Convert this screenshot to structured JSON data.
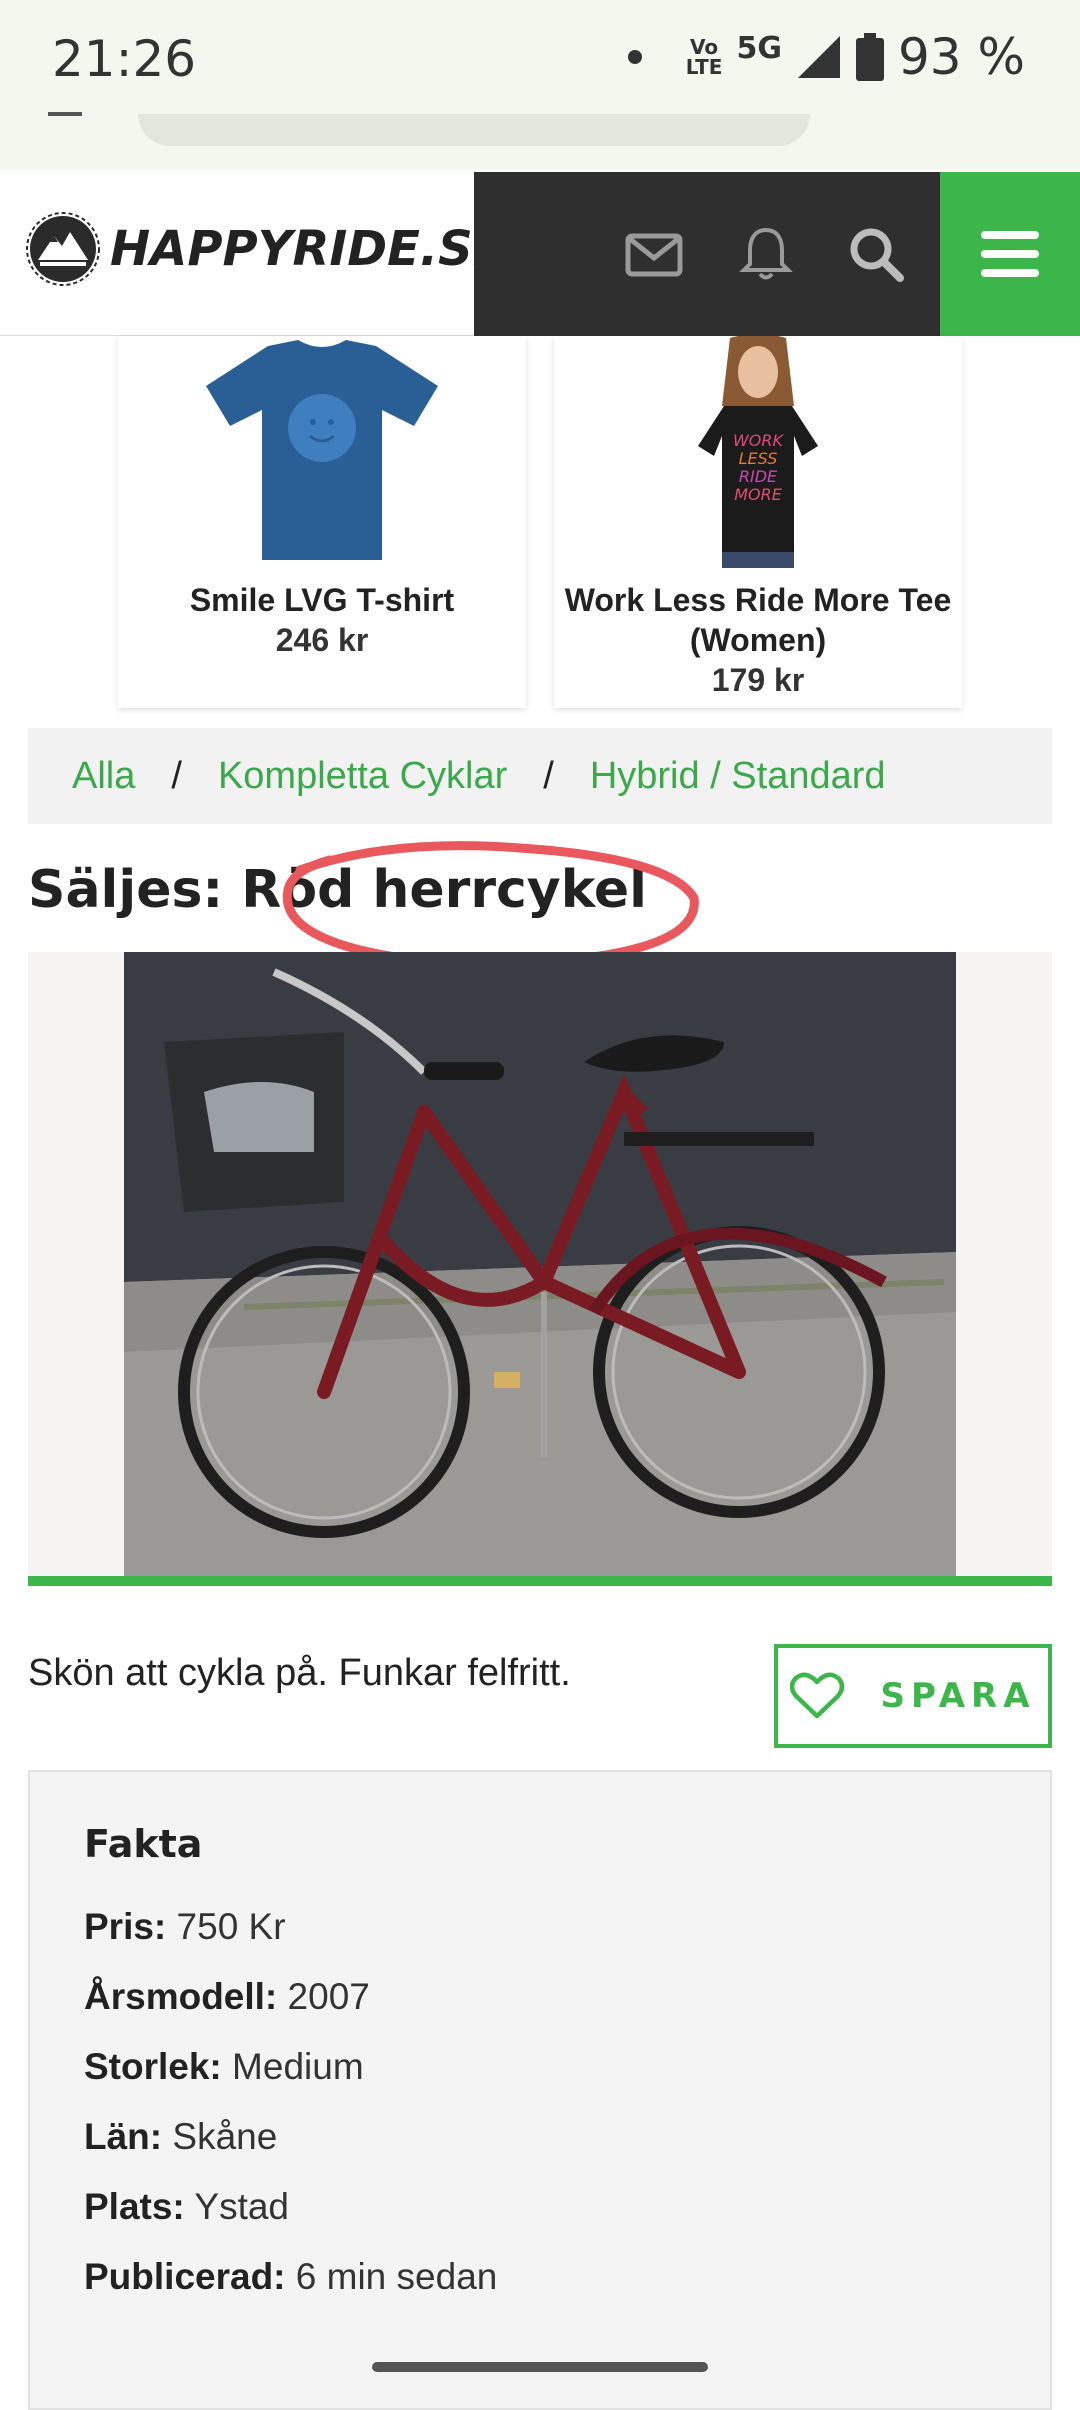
{
  "status_bar": {
    "time": "21:26",
    "volte_top": "Vo",
    "volte_bottom": "LTE",
    "network": "5G",
    "battery": "93 %"
  },
  "header": {
    "logo_text": "HAPPYRIDE.SE",
    "icons": [
      "mail-icon",
      "bell-icon",
      "search-icon",
      "hamburger-menu-icon"
    ],
    "accent_color": "#3cb54a"
  },
  "products": [
    {
      "name": "Smile LVG T-shirt",
      "price": "246 kr"
    },
    {
      "name": "Work Less Ride More Tee (Women)",
      "price": "179 kr"
    }
  ],
  "breadcrumb": {
    "items": [
      "Alla",
      "Kompletta Cyklar",
      "Hybrid / Standard"
    ],
    "separator": "/"
  },
  "listing": {
    "title": "Säljes: Röd herrcykel",
    "description": "Skön att cykla på. Funkar felfritt.",
    "save_label": "SPARA"
  },
  "fakta": {
    "title": "Fakta",
    "rows": [
      {
        "label": "Pris:",
        "value": "750 Kr"
      },
      {
        "label": "Årsmodell:",
        "value": "2007"
      },
      {
        "label": "Storlek:",
        "value": "Medium"
      },
      {
        "label": "Län:",
        "value": "Skåne"
      },
      {
        "label": "Plats:",
        "value": "Ystad"
      },
      {
        "label": "Publicerad:",
        "value": "6 min sedan"
      }
    ]
  }
}
